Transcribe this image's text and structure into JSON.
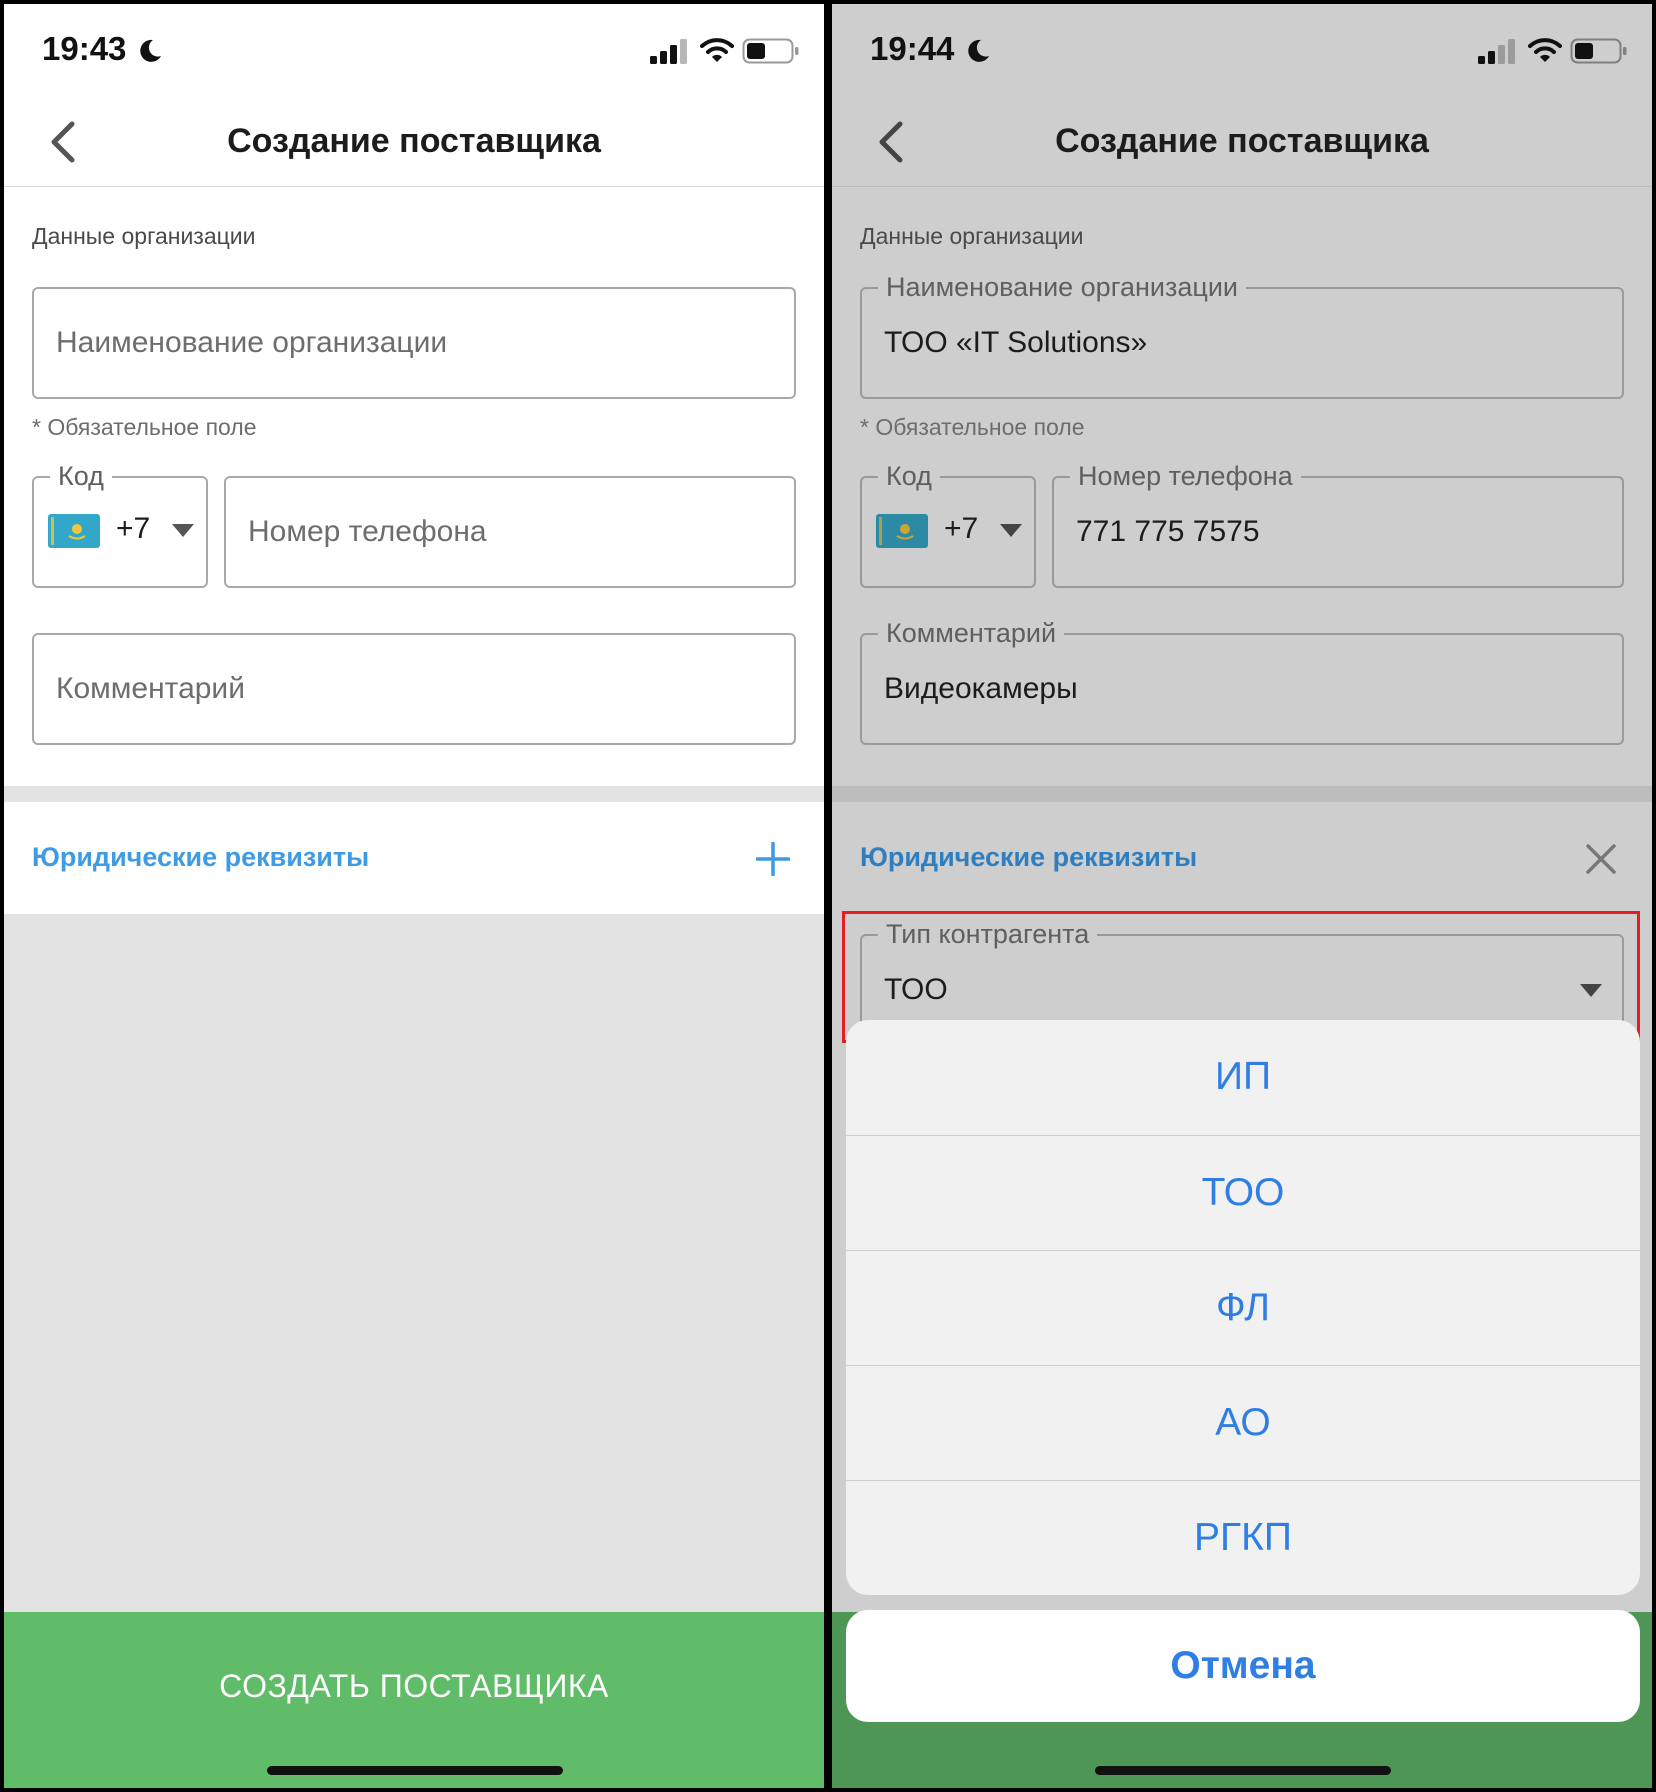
{
  "left_screen": {
    "status": {
      "time": "19:43"
    },
    "nav": {
      "title": "Создание поставщика"
    },
    "section_caption": "Данные организации",
    "org_name": {
      "placeholder": "Наименование организации"
    },
    "required_hint": "* Обязательное поле",
    "code": {
      "label": "Код",
      "value": "+7"
    },
    "phone": {
      "placeholder": "Номер телефона"
    },
    "comment": {
      "placeholder": "Комментарий"
    },
    "legal": {
      "title": "Юридические реквизиты",
      "icon": "plus-icon"
    },
    "create_button": {
      "label": "СОЗДАТЬ ПОСТАВЩИКА"
    }
  },
  "right_screen": {
    "status": {
      "time": "19:44"
    },
    "nav": {
      "title": "Создание поставщика"
    },
    "section_caption": "Данные организации",
    "org_name": {
      "label": "Наименование организации",
      "value": "ТОО «IT Solutions»"
    },
    "required_hint": "* Обязательное поле",
    "code": {
      "label": "Код",
      "value": "+7"
    },
    "phone": {
      "label": "Номер телефона",
      "value": "771 775 7575"
    },
    "comment": {
      "label": "Комментарий",
      "value": "Видеокамеры"
    },
    "legal": {
      "title": "Юридические реквизиты",
      "icon": "close-icon"
    },
    "counterparty_type": {
      "label": "Тип контрагента",
      "value": "ТОО"
    },
    "action_sheet": {
      "options": [
        "ИП",
        "ТОО",
        "ФЛ",
        "АО",
        "РГКП"
      ],
      "cancel": "Отмена"
    }
  },
  "colors": {
    "accent_blue": "#3e9be4",
    "sheet_blue": "#2f7ee3",
    "create_green": "#60bc69",
    "highlight_red": "#e31e26"
  }
}
